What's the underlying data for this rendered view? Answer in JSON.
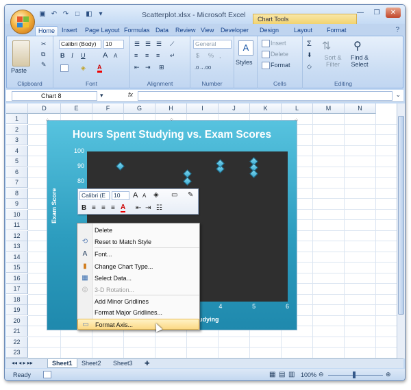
{
  "window": {
    "title": "Scatterplot.xlsx - Microsoft Excel",
    "context_tab": "Chart Tools"
  },
  "tabs": [
    "Home",
    "Insert",
    "Page Layout",
    "Formulas",
    "Data",
    "Review",
    "View",
    "Developer",
    "Design",
    "Layout",
    "Format"
  ],
  "ribbon": {
    "clipboard": {
      "paste": "Paste",
      "label": "Clipboard"
    },
    "font": {
      "face": "Calibri (Body)",
      "size": "10",
      "label": "Font",
      "bold": "B",
      "italic": "I",
      "underline": "U",
      "grow": "A",
      "shrink": "A"
    },
    "alignment": {
      "label": "Alignment"
    },
    "number": {
      "format": "General",
      "currency": "$",
      "percent": "%",
      "comma": ",",
      "label": "Number"
    },
    "styles": {
      "label": "Styles"
    },
    "cells": {
      "insert": "Insert",
      "delete": "Delete",
      "format": "Format",
      "label": "Cells"
    },
    "editing": {
      "sum": "Σ",
      "sort": "Sort & Filter",
      "find": "Find & Select",
      "label": "Editing"
    }
  },
  "formula_bar": {
    "name_box": "Chart 8",
    "fx": "fx"
  },
  "columns": [
    "D",
    "E",
    "F",
    "G",
    "H",
    "I",
    "J",
    "K",
    "L",
    "M",
    "N"
  ],
  "rows": [
    "1",
    "2",
    "3",
    "4",
    "5",
    "6",
    "7",
    "8",
    "9",
    "10",
    "11",
    "12",
    "13",
    "14",
    "15",
    "16",
    "17",
    "18",
    "19",
    "20",
    "21",
    "22",
    "23"
  ],
  "sheets": [
    "Sheet1",
    "Sheet2",
    "Sheet3"
  ],
  "status": {
    "ready": "Ready",
    "zoom": "100%"
  },
  "chart_data": {
    "type": "scatter",
    "title": "Hours Spent Studying vs. Exam Scores",
    "ylabel": "Exam Score",
    "xlabel_visible": "udying",
    "ylim": [
      0,
      100
    ],
    "xlim": [
      0,
      6
    ],
    "y_ticks": [
      "100",
      "90",
      "80",
      "70",
      "60",
      "50",
      "40",
      "30",
      "20",
      "10",
      "0"
    ],
    "x_ticks_visible": [
      "4",
      "5",
      "6"
    ],
    "series": [
      {
        "x": [
          1,
          3,
          3,
          4,
          4,
          5,
          5,
          5
        ],
        "y": [
          90,
          80,
          85,
          88,
          92,
          93,
          89,
          85
        ]
      }
    ]
  },
  "mini_toolbar": {
    "font": "Calibri (E",
    "size": "10"
  },
  "context_menu": [
    {
      "label": "Delete",
      "icon": "",
      "enabled": true
    },
    {
      "label": "Reset to Match Style",
      "icon": "reset-style-icon",
      "enabled": true
    },
    {
      "label": "Font...",
      "icon": "font-icon",
      "enabled": true
    },
    {
      "label": "Change Chart Type...",
      "icon": "chart-type-icon",
      "enabled": true
    },
    {
      "label": "Select Data...",
      "icon": "select-data-icon",
      "enabled": true
    },
    {
      "label": "3-D Rotation...",
      "icon": "rotation-icon",
      "enabled": false
    },
    {
      "label": "Add Minor Gridlines",
      "icon": "",
      "enabled": true
    },
    {
      "label": "Format Major Gridlines...",
      "icon": "",
      "enabled": true
    },
    {
      "label": "Format Axis...",
      "icon": "format-axis-icon",
      "enabled": true
    }
  ]
}
